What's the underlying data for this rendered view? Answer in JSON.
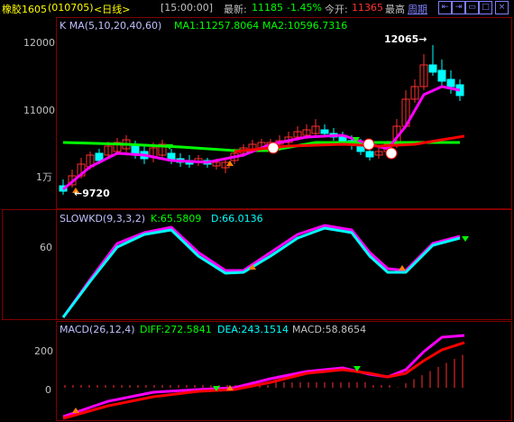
{
  "topbar": {
    "name": "橡胶1605",
    "code": "(010705)",
    "period": "<日线>",
    "time": "[15:00:00]",
    "latest_label": "最新:",
    "latest_value": "11185",
    "change_pct": "-1.45%",
    "open_label": "今开:",
    "open_value": "11365",
    "high_label": "最高",
    "cycle_label": "周期"
  },
  "kline": {
    "title": "K  MA(5,10,20,40,60)",
    "ma1": "MA1:11257.8064",
    "ma2": "MA2:10596.7316",
    "y_labels": [
      "12000",
      "11000",
      "1万"
    ],
    "high_marker": "12065→",
    "low_marker": "←9720"
  },
  "kd": {
    "title": "SLOWKD(9,3,3,2)",
    "k": "K:65.5809",
    "d": "D:66.0136",
    "y_labels": [
      "60"
    ]
  },
  "macd": {
    "title": "MACD(26,12,4)",
    "diff": "DIFF:272.5841",
    "dea": "DEA:243.1514",
    "macd": "MACD:58.8654",
    "y_labels": [
      "200",
      "0"
    ]
  },
  "colors": {
    "up": "#ff3030",
    "down": "#00ffff",
    "ma_magenta": "#ff00ff",
    "ma_green": "#00ff00",
    "ma_red": "#ff0000",
    "grid": "#800000",
    "title_blue": "#c0c0ff",
    "value_cyan": "#00ffff",
    "value_green": "#00ff00"
  }
}
